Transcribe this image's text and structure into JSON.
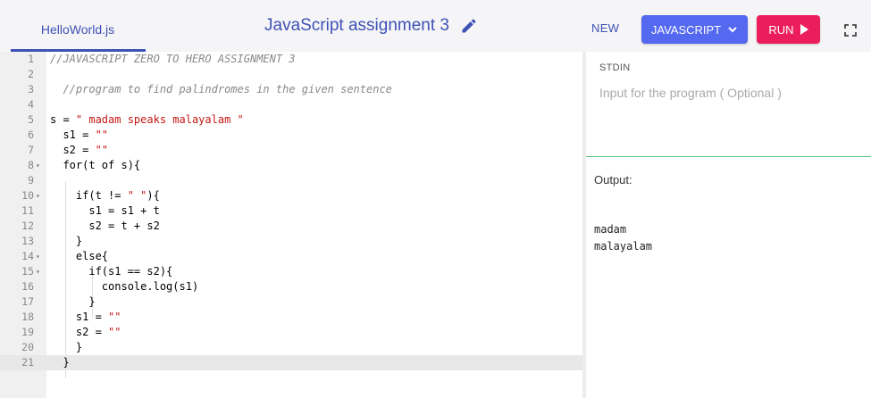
{
  "header": {
    "file_tab": "HelloWorld.js",
    "title": "JavaScript assignment 3",
    "new_label": "NEW",
    "language_label": "JAVASCRIPT",
    "run_label": "RUN",
    "edit_icon": "pencil-icon",
    "dropdown_icon": "chevron-down-icon",
    "run_icon": "play-icon",
    "fullscreen_icon": "fullscreen-icon"
  },
  "colors": {
    "accent": "#3f51b5",
    "language_button": "#5468f0",
    "run_button": "#ec1d5b",
    "divider": "#5cc47a"
  },
  "editor": {
    "active_line": 21,
    "lines": [
      {
        "n": "1",
        "text": "//JAVASCRIPT ZERO TO HERO ASSIGNMENT 3"
      },
      {
        "n": "2",
        "text": ""
      },
      {
        "n": "3",
        "text": "  //program to find palindromes in the given sentence"
      },
      {
        "n": "4",
        "text": ""
      },
      {
        "n": "5",
        "text": "s = \" madam speaks malayalam \""
      },
      {
        "n": "6",
        "text": "  s1 = \"\""
      },
      {
        "n": "7",
        "text": "  s2 = \"\""
      },
      {
        "n": "8",
        "text": "  for(t of s){"
      },
      {
        "n": "9",
        "text": ""
      },
      {
        "n": "10",
        "text": "    if(t != \" \"){"
      },
      {
        "n": "11",
        "text": "      s1 = s1 + t"
      },
      {
        "n": "12",
        "text": "      s2 = t + s2"
      },
      {
        "n": "13",
        "text": "    }"
      },
      {
        "n": "14",
        "text": "    else{"
      },
      {
        "n": "15",
        "text": "      if(s1 == s2){"
      },
      {
        "n": "16",
        "text": "        console.log(s1)"
      },
      {
        "n": "17",
        "text": "      }"
      },
      {
        "n": "18",
        "text": "    s1 = \"\""
      },
      {
        "n": "19",
        "text": "    s2 = \"\""
      },
      {
        "n": "20",
        "text": "    }"
      },
      {
        "n": "21",
        "text": "  }"
      }
    ]
  },
  "stdin": {
    "label": "STDIN",
    "placeholder": "Input for the program ( Optional )"
  },
  "output": {
    "label": "Output:",
    "text": "madam\nmalayalam"
  }
}
